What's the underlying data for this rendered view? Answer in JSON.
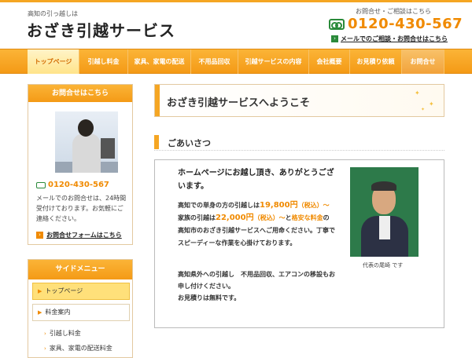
{
  "header": {
    "tagline": "高知の引っ越しは",
    "title": "おざき引越サービス",
    "contact_label": "お問合せ・ご相談はこちら",
    "phone": "0120-430-567",
    "mail_link": "メールでのご相談・お問合せはこちら",
    "accent_color": "#f08a00"
  },
  "nav": {
    "items": [
      {
        "label": "トップページ"
      },
      {
        "label": "引越し料金"
      },
      {
        "label": "家具、家電の配送"
      },
      {
        "label": "不用品回収"
      },
      {
        "label": "引越サービスの内容"
      },
      {
        "label": "会社概要"
      },
      {
        "label": "お見積り依頼"
      },
      {
        "label": "お問合せ"
      }
    ]
  },
  "sidebar": {
    "contact": {
      "heading": "お問合せはこちら",
      "phone": "0120-430-567",
      "description": "メールでのお問合せは、24時間受付けております。お気軽にご連絡ください。",
      "form_link": "お問合せフォームはこちら"
    },
    "menu": {
      "heading": "サイドメニュー",
      "top": "トップページ",
      "pricing": "料金案内",
      "children": [
        "引越し料金",
        "家具、家電の配送料金"
      ]
    }
  },
  "main": {
    "welcome": "おざき引越サービスへようこそ",
    "greeting_heading": "ごあいさつ",
    "lead": "ホームページにお越し頂き、ありがとうございます。",
    "p1": {
      "t1": "高知での単身の方の引越しは",
      "price1": "19,800円",
      "tax1": "（税込）〜",
      "t2": "　家族の引越は",
      "price2": "22,000円",
      "tax2": "（税込）〜",
      "t3": "と",
      "cheap": "格安な料金",
      "t4": "の高知市のおざき引越サービスへご用命ください。丁寧でスピーディーな作業を心掛けております。"
    },
    "p2": "高知県外への引越し　不用品回収、エアコンの移設もお申し付けください。",
    "p3": "お見積りは無料です。",
    "photo_caption": "代表の尾崎 です"
  }
}
